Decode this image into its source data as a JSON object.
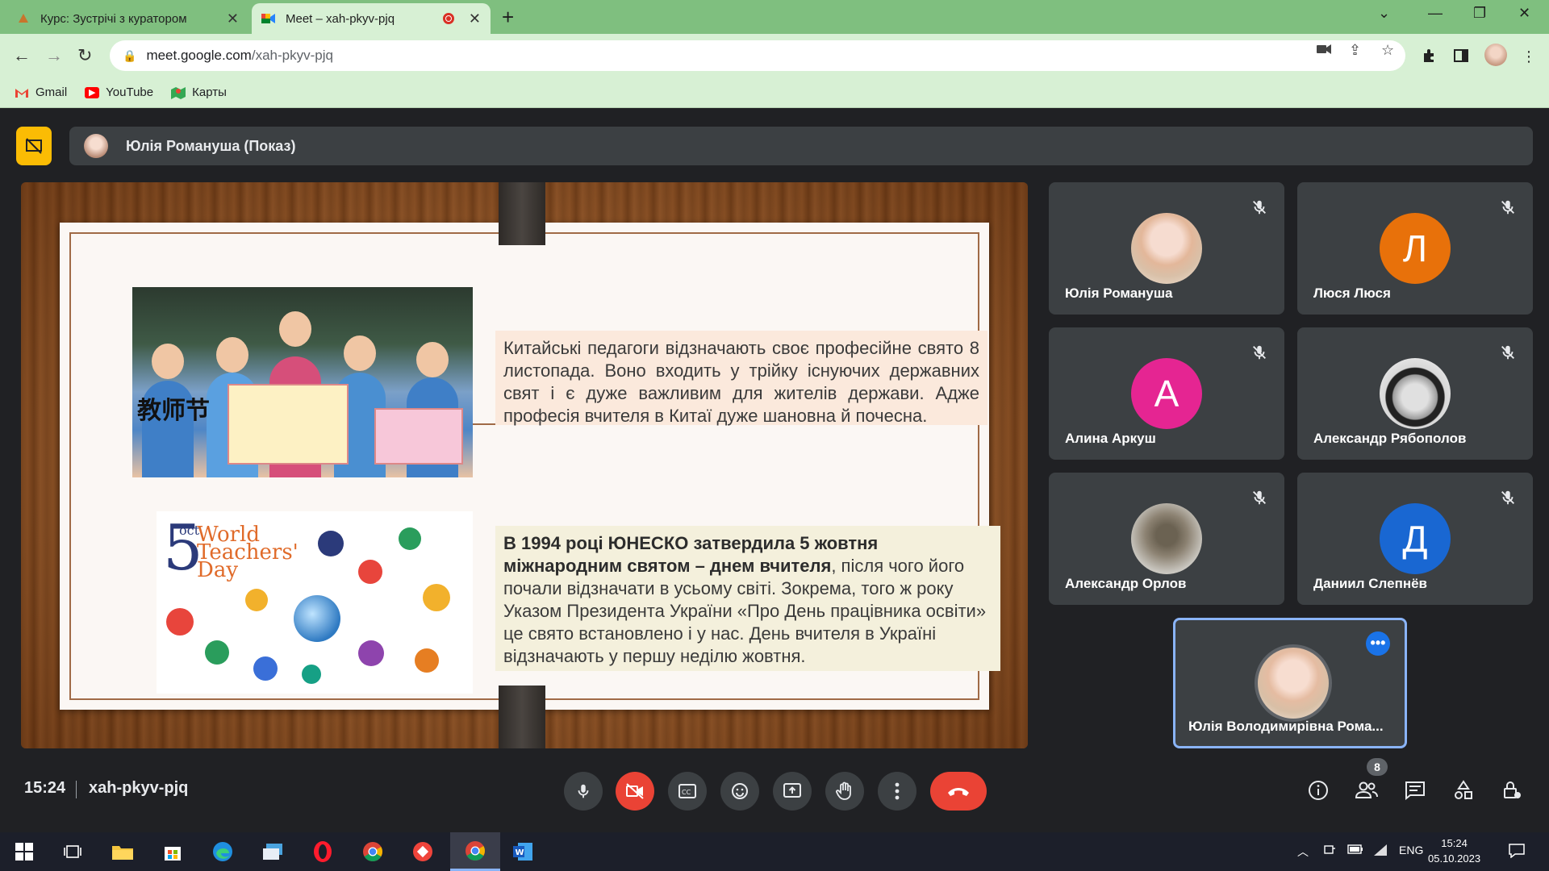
{
  "browser": {
    "tabs": [
      {
        "title": "Курс: Зустрічі з куратором",
        "active": false
      },
      {
        "title": "Meet – xah-pkyv-pjq",
        "active": true
      }
    ],
    "url_host": "meet.google.com",
    "url_path": "/xah-pkyv-pjq",
    "bookmarks": [
      {
        "label": "Gmail"
      },
      {
        "label": "YouTube"
      },
      {
        "label": "Карты"
      }
    ]
  },
  "meet": {
    "presenter_label": "Юлія Романуша (Показ)",
    "slide": {
      "para1": "Китайські педагоги відзначають своє професійне свято 8 листопада. Воно входить у трійку існуючих державних свят і є дуже важливим для жителів держави. Адже професія вчителя в Китаї дуже шановна й почесна.",
      "para2_bold": "В 1994 році ЮНЕСКО затвердила 5 жовтня міжнародним святом – днем вчителя",
      "para2_rest": ", після чого його почали відзначати в усьому світі. Зокрема, того ж року Указом Президента України «Про День працівника освіти» це свято встановлено і у нас. День вчителя в Україні відзначають у першу неділю жовтня.",
      "img1_chars": "教师节",
      "img2_num": "5",
      "img2_oct": "oct",
      "img2_title": "World Teachers' Day"
    },
    "participants": [
      {
        "name": "Юлія Романуша",
        "initial": "",
        "color": "",
        "muted": true
      },
      {
        "name": "Люся Люся",
        "initial": "Л",
        "color": "#e8710a",
        "muted": true
      },
      {
        "name": "Алина Аркуш",
        "initial": "А",
        "color": "#e52592",
        "muted": true
      },
      {
        "name": "Александр Рябополов",
        "initial": "",
        "color": "",
        "muted": true
      },
      {
        "name": "Александр Орлов",
        "initial": "",
        "color": "",
        "muted": true
      },
      {
        "name": "Даниил Слепнёв",
        "initial": "Д",
        "color": "#1967d2",
        "muted": true
      }
    ],
    "self_name": "Юлія Володимирівна Рома...",
    "time": "15:24",
    "meeting_code": "xah-pkyv-pjq",
    "participant_count": "8"
  },
  "taskbar": {
    "lang": "ENG",
    "time": "15:24",
    "date": "05.10.2023"
  }
}
